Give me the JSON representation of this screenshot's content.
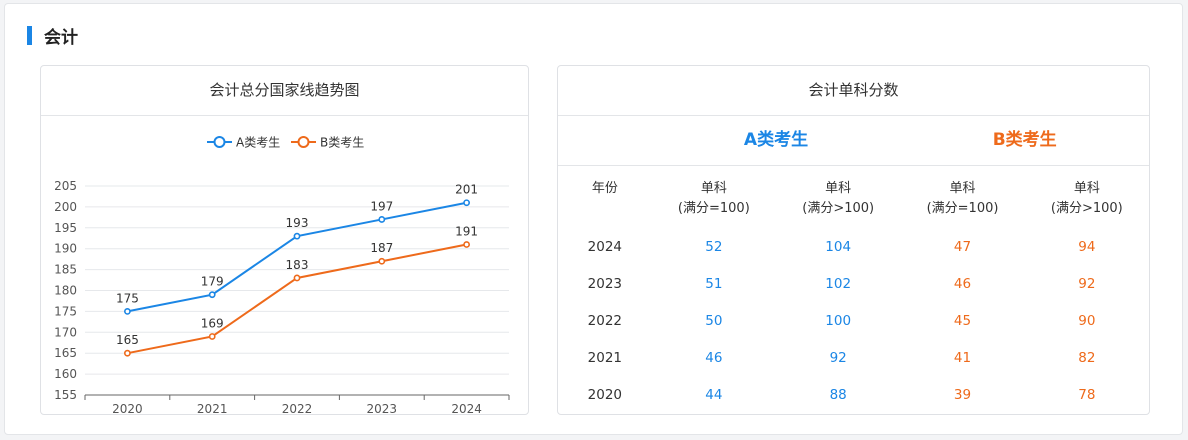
{
  "section": {
    "title": "会计"
  },
  "chart_card": {
    "title": "会计总分国家线趋势图"
  },
  "chart_data": {
    "type": "line",
    "title": "会计总分国家线趋势图",
    "categories": [
      "2020",
      "2021",
      "2022",
      "2023",
      "2024"
    ],
    "series": [
      {
        "name": "A类考生",
        "color": "#1b86e5",
        "values": [
          175,
          179,
          193,
          197,
          201
        ]
      },
      {
        "name": "B类考生",
        "color": "#ee6a1b",
        "values": [
          165,
          169,
          183,
          187,
          191
        ]
      }
    ],
    "ylim": [
      155,
      205
    ],
    "yticks": [
      155,
      160,
      165,
      170,
      175,
      180,
      185,
      190,
      195,
      200,
      205
    ],
    "grid": true,
    "legend": "top-center",
    "data_labels": true
  },
  "table_card": {
    "title": "会计单科分数",
    "group_a": "A类考生",
    "group_b": "B类考生",
    "headers": {
      "year": "年份",
      "col_line1": "单科",
      "full_eq": "(满分=100)",
      "full_gt": "(满分>100)"
    },
    "rows": [
      {
        "year": "2024",
        "a1": "52",
        "a2": "104",
        "b1": "47",
        "b2": "94"
      },
      {
        "year": "2023",
        "a1": "51",
        "a2": "102",
        "b1": "46",
        "b2": "92"
      },
      {
        "year": "2022",
        "a1": "50",
        "a2": "100",
        "b1": "45",
        "b2": "90"
      },
      {
        "year": "2021",
        "a1": "46",
        "a2": "92",
        "b1": "41",
        "b2": "82"
      },
      {
        "year": "2020",
        "a1": "44",
        "a2": "88",
        "b1": "39",
        "b2": "78"
      }
    ]
  },
  "colors": {
    "accent_a": "#1b86e5",
    "accent_b": "#ee6a1b",
    "section_bar": "#1b86e5"
  }
}
